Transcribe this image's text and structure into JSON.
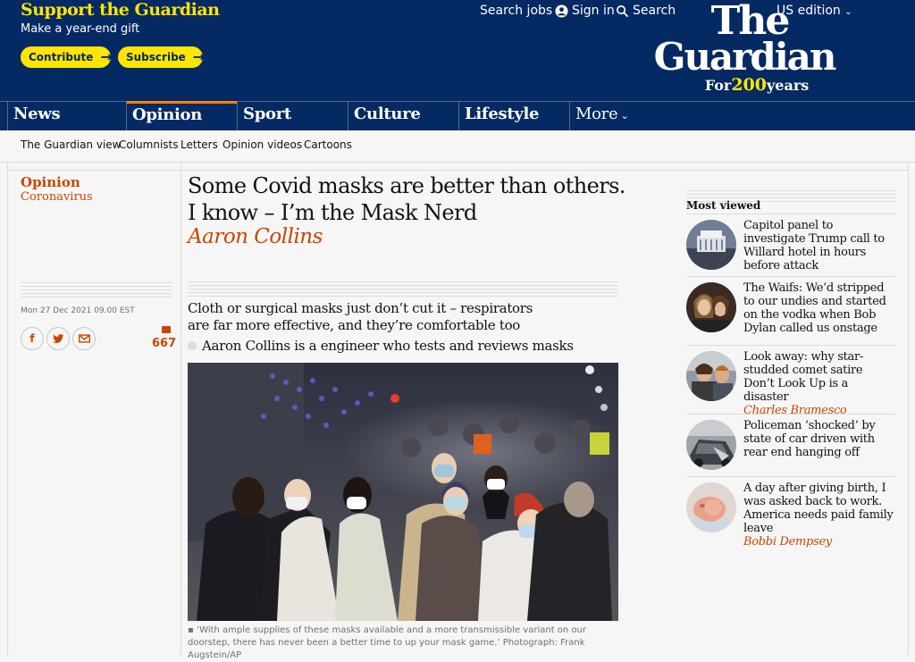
{
  "support": {
    "title": "Support the Guardian",
    "subtitle": "Make a year-end gift",
    "contribute_label": "Contribute",
    "subscribe_label": "Subscribe"
  },
  "toplinks": {
    "jobs": "Search jobs",
    "signin": "Sign in",
    "search": "Search",
    "edition": "US edition"
  },
  "logo": {
    "the": "The",
    "guardian": "Guardian",
    "for": "For",
    "num": "200",
    "years": "years"
  },
  "nav": {
    "items": [
      "News",
      "Opinion",
      "Sport",
      "Culture",
      "Lifestyle"
    ],
    "more": "More"
  },
  "subnav": {
    "items": [
      "The Guardian view",
      "Columnists",
      "Letters",
      "Opinion videos",
      "Cartoons"
    ]
  },
  "article": {
    "kicker": "Opinion",
    "series": "Coronavirus",
    "headline": "Some Covid masks are better than others. I know – I’m the Mask Nerd",
    "byline": "Aaron Collins",
    "dateline": "Mon 27 Dec 2021 09.00 EST",
    "comment_count": "667",
    "standfirst": "Cloth or surgical masks just don’t cut it – respirators are far more effective, and they’re comfortable too",
    "bio": "Aaron Collins is a engineer who tests and reviews masks",
    "caption": "‘With ample supplies of these masks available and a more transmissible variant on our doorstep, there has never been a better time to up your mask game.’ Photograph: Frank Augstein/AP"
  },
  "most_viewed": {
    "title": "Most viewed",
    "items": [
      {
        "headline": "Capitol panel to investigate Trump call to Willard hotel in hours before attack",
        "author": ""
      },
      {
        "headline": "The Waifs: We’d stripped to our undies and started on the vodka when Bob Dylan called us onstage",
        "author": ""
      },
      {
        "headline": "Look away: why star-studded comet satire Don’t Look Up is a disaster",
        "author": "Charles Bramesco"
      },
      {
        "headline": "Policeman ‘shocked’ by state of car driven with rear end hanging off",
        "author": ""
      },
      {
        "headline": "A day after giving birth, I was asked back to work. America needs paid family leave",
        "author": "Bobbi Dempsey"
      }
    ]
  },
  "colors": {
    "brand": "#052962",
    "accent": "#ffe500",
    "opinion": "#c74600"
  }
}
